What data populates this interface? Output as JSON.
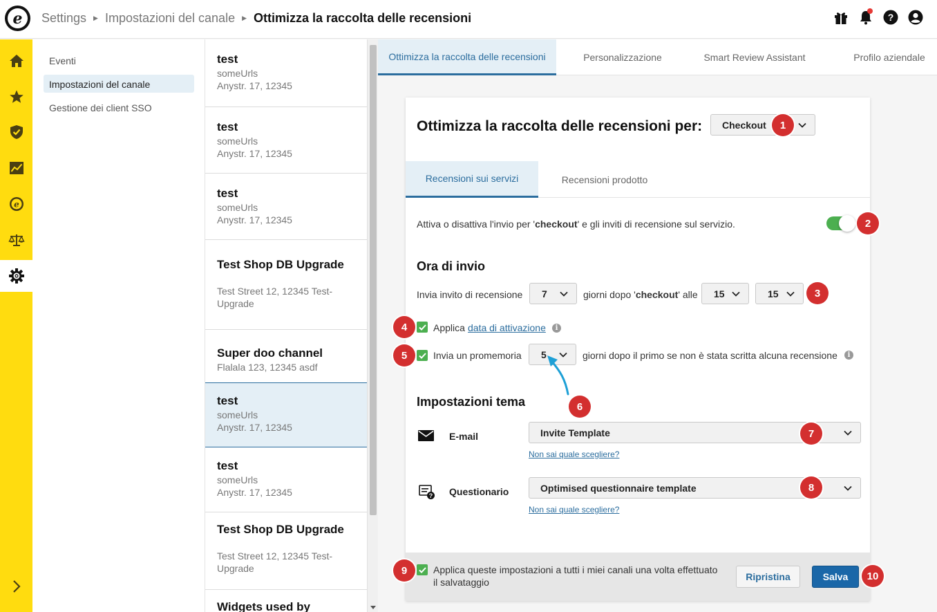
{
  "breadcrumb": {
    "items": [
      "Settings",
      "Impostazioni del canale"
    ],
    "current": "Ottimizza la raccolta delle recensioni"
  },
  "rail": {
    "icons": [
      "home-icon",
      "star-icon",
      "shield-check-icon",
      "chart-icon",
      "trusted-e-icon",
      "scales-icon",
      "gear-icon"
    ],
    "active": "gear-icon"
  },
  "subnav": {
    "items": [
      "Eventi",
      "Impostazioni del canale",
      "Gestione dei client SSO"
    ],
    "active": "Impostazioni del canale"
  },
  "channels": [
    {
      "name": "test",
      "line1": "someUrls",
      "line2": "Anystr. 17, 12345"
    },
    {
      "name": "test",
      "line1": "someUrls",
      "line2": "Anystr. 17, 12345"
    },
    {
      "name": "test",
      "line1": "someUrls",
      "line2": "Anystr. 17, 12345"
    },
    {
      "name": "Test Shop DB Upgrade",
      "line1": "Test Street 12, 12345 Test-",
      "line2": "Upgrade"
    },
    {
      "name": "Super doo channel",
      "line1": "Flalala 123, 12345 asdf",
      "line2": ""
    },
    {
      "name": "test",
      "line1": "someUrls",
      "line2": "Anystr. 17, 12345",
      "active": true
    },
    {
      "name": "test",
      "line1": "someUrls",
      "line2": "Anystr. 17, 12345"
    },
    {
      "name": "Test Shop DB Upgrade",
      "line1": "Test Street 12, 12345 Test-",
      "line2": "Upgrade"
    },
    {
      "name": "Widgets used by",
      "line1": "",
      "line2": ""
    }
  ],
  "tabs": [
    "Ottimizza la raccolta delle recensioni",
    "Personalizzazione",
    "Smart Review Assistant",
    "Profilo aziendale"
  ],
  "card": {
    "title": "Ottimizza la raccolta delle recensioni per:",
    "event_select": "Checkout",
    "inner_tabs": [
      "Recensioni sui servizi",
      "Recensioni prodotto"
    ],
    "toggle_text_pre": "Attiva o disattiva l'invio per '",
    "toggle_text_bold": "checkout",
    "toggle_text_post": "' e gli inviti di recensione sul servizio.",
    "toggle_on": true,
    "send_time_heading": "Ora di invio",
    "send_label": "Invia invito di recensione",
    "days_value": "7",
    "days_after_pre": "giorni dopo '",
    "days_after_bold": "checkout",
    "days_after_post": "' alle",
    "hour_value": "15",
    "minute_value": "15",
    "apply_label": "Applica",
    "apply_link": "data di attivazione",
    "apply_checked": true,
    "reminder_label": "Invia un promemoria",
    "reminder_checked": true,
    "reminder_days": "5",
    "reminder_text": "giorni dopo il primo se non è stata scritta alcuna recensione",
    "theme_heading": "Impostazioni tema",
    "email_label": "E-mail",
    "email_template": "Invite Template",
    "questionnaire_label": "Questionario",
    "questionnaire_template": "Optimised questionnaire template",
    "help_link": "Non sai quale scegliere?",
    "footer_text_1": "Applica queste impostazioni a tutti i miei canali una volta effettuato",
    "footer_text_2": "il salvataggio",
    "footer_checked": true,
    "reset_label": "Ripristina",
    "save_label": "Salva"
  },
  "markers": [
    "1",
    "2",
    "3",
    "4",
    "5",
    "6",
    "7",
    "8",
    "9",
    "10"
  ],
  "colors": {
    "rail": "#ffdc0f",
    "accent": "#2b6d9e",
    "toggle": "#4caf50",
    "marker": "#d32f2f",
    "annotation_arrow": "#1ea0d6"
  }
}
